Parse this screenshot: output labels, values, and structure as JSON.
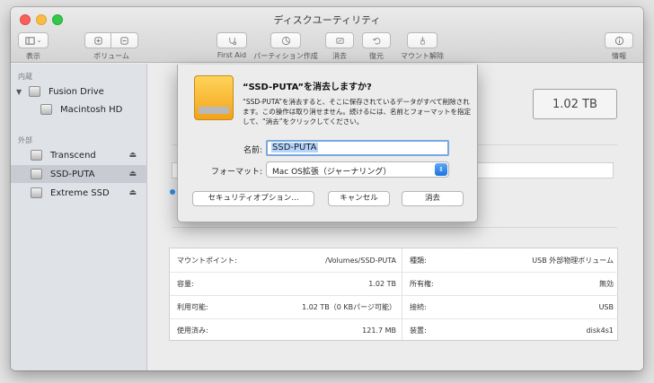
{
  "window": {
    "title": "ディスクユーティリティ"
  },
  "toolbar": {
    "view_label": "表示",
    "volume_label": "ボリューム",
    "first_aid_label": "First Aid",
    "partition_label": "パーティション作成",
    "erase_label": "消去",
    "restore_label": "復元",
    "unmount_label": "マウント解除",
    "info_label": "情報"
  },
  "sidebar": {
    "internal_header": "内蔵",
    "external_header": "外部",
    "items": [
      {
        "label": "Fusion Drive"
      },
      {
        "label": "Macintosh HD"
      },
      {
        "label": "Transcend"
      },
      {
        "label": "SSD-PUTA"
      },
      {
        "label": "Extreme SSD"
      }
    ]
  },
  "main": {
    "capacity": "1.02 TB"
  },
  "info": {
    "rows_left": [
      {
        "key": "マウントポイント:",
        "value": "/Volumes/SSD-PUTA"
      },
      {
        "key": "容量:",
        "value": "1.02 TB"
      },
      {
        "key": "利用可能:",
        "value": "1.02 TB（0 KBパージ可能）"
      },
      {
        "key": "使用済み:",
        "value": "121.7 MB"
      }
    ],
    "rows_right": [
      {
        "key": "種類:",
        "value": "USB 外部物理ボリューム"
      },
      {
        "key": "所有権:",
        "value": "無効"
      },
      {
        "key": "接続:",
        "value": "USB"
      },
      {
        "key": "装置:",
        "value": "disk4s1"
      }
    ]
  },
  "dialog": {
    "title": "“SSD-PUTA”を消去しますか?",
    "message": "“SSD-PUTA”を消去すると、そこに保存されているデータがすべて削除されます。この操作は取り消せません。続けるには、名前とフォーマットを指定して、“消去”をクリックしてください。",
    "name_label": "名前:",
    "name_value": "SSD-PUTA",
    "format_label": "フォーマット:",
    "format_value": "Mac OS拡張（ジャーナリング）",
    "security_button": "セキュリティオプション...",
    "cancel_button": "キャンセル",
    "erase_button": "消去"
  }
}
